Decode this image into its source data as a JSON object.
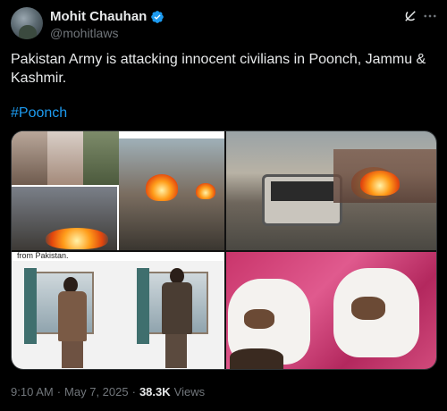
{
  "author": {
    "display_name": "Mohit Chauhan",
    "handle": "@mohitlaws",
    "verified": true
  },
  "icons": {
    "verified": "verified-badge-icon",
    "grok": "grok-icon",
    "more": "more-icon"
  },
  "colors": {
    "background": "#000000",
    "text": "#e7e9ea",
    "secondary": "#71767b",
    "link": "#1d9bf0"
  },
  "post": {
    "text": "Pakistan Army is attacking innocent civilians in Poonch, Jammu & Kashmir.",
    "hashtag": "#Poonch",
    "media_caption_fragment": "from Pakistan."
  },
  "meta": {
    "time": "9:10 AM",
    "separator": "·",
    "date": "May 7, 2025",
    "views_count": "38.3K",
    "views_label": "Views"
  }
}
